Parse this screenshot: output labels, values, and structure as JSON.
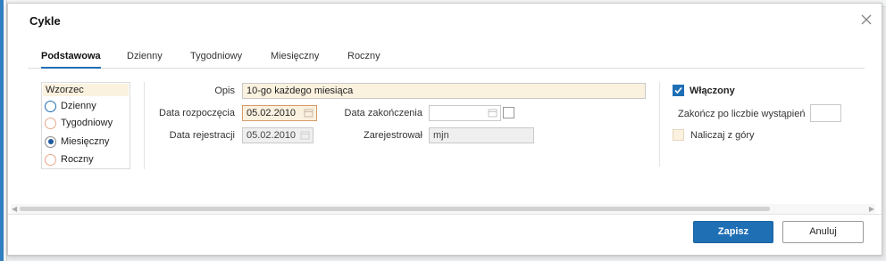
{
  "dialog": {
    "title": "Cykle",
    "close_icon": "close-icon"
  },
  "tabs": [
    {
      "label": "Podstawowa",
      "active": true
    },
    {
      "label": "Dzienny",
      "active": false
    },
    {
      "label": "Tygodniowy",
      "active": false
    },
    {
      "label": "Miesięczny",
      "active": false
    },
    {
      "label": "Roczny",
      "active": false
    }
  ],
  "pattern": {
    "title": "Wzorzec",
    "options": [
      {
        "label": "Dzienny",
        "selected": false
      },
      {
        "label": "Tygodniowy",
        "selected": false
      },
      {
        "label": "Miesięczny",
        "selected": true
      },
      {
        "label": "Roczny",
        "selected": false
      }
    ]
  },
  "form": {
    "description_label": "Opis",
    "description_value": "10-go każdego miesiąca",
    "start_date_label": "Data rozpoczęcia",
    "start_date_value": "05.02.2010",
    "end_date_label": "Data zakończenia",
    "end_date_value": "",
    "registration_date_label": "Data rejestracji",
    "registration_date_value": "05.02.2010",
    "registered_by_label": "Zarejestrował",
    "registered_by_value": "mjn"
  },
  "options": {
    "enabled_label": "Włączony",
    "enabled_checked": true,
    "end_after_label": "Zakończ po liczbie wystąpień",
    "end_after_value": "",
    "charge_ahead_label": "Naliczaj z góry",
    "charge_ahead_checked": false
  },
  "footer": {
    "save_label": "Zapisz",
    "cancel_label": "Anuluj"
  },
  "colors": {
    "accent": "#1f6fb5",
    "field_highlight": "#fbf1df"
  }
}
